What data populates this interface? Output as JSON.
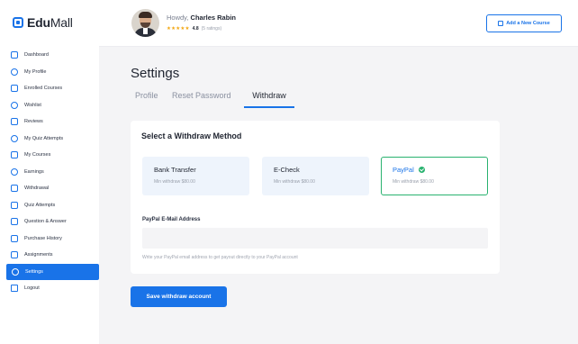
{
  "brand": {
    "part1": "Edu",
    "part2": "Mall",
    "color": "#1973e8"
  },
  "sidebar": {
    "items": [
      {
        "label": "Dashboard",
        "icon": "dashboard-icon"
      },
      {
        "label": "My Profile",
        "icon": "user-icon"
      },
      {
        "label": "Enrolled Courses",
        "icon": "courses-icon"
      },
      {
        "label": "Wishlist",
        "icon": "heart-icon"
      },
      {
        "label": "Reviews",
        "icon": "star-icon"
      },
      {
        "label": "My Quiz Attempts",
        "icon": "quiz-icon"
      },
      {
        "label": "My Courses",
        "icon": "monitor-icon"
      },
      {
        "label": "Earnings",
        "icon": "dollar-icon"
      },
      {
        "label": "Withdrawal",
        "icon": "wallet-icon"
      },
      {
        "label": "Quiz Attempts",
        "icon": "question-icon"
      },
      {
        "label": "Question & Answer",
        "icon": "chat-icon"
      },
      {
        "label": "Purchase History",
        "icon": "cart-icon"
      },
      {
        "label": "Assignments",
        "icon": "clipboard-icon"
      },
      {
        "label": "Settings",
        "icon": "gear-icon",
        "active": true
      },
      {
        "label": "Logout",
        "icon": "logout-icon"
      }
    ]
  },
  "header": {
    "greeting": "Howdy, ",
    "user_name": "Charles Rabin",
    "stars": "★★★★★",
    "rating_score": "4.8",
    "rating_count": "(5 ratings)",
    "add_course_label": "Add a New Course"
  },
  "main": {
    "title": "Settings",
    "tabs": [
      {
        "label": "Profile"
      },
      {
        "label": "Reset Password"
      },
      {
        "label": "Withdraw",
        "active": true
      }
    ],
    "withdraw": {
      "heading": "Select a Withdraw Method",
      "methods": [
        {
          "name": "Bank Transfer",
          "min": "Min withdraw $80.00"
        },
        {
          "name": "E-Check",
          "min": "Min withdraw $80.00"
        },
        {
          "name": "PayPal",
          "min": "Min withdraw $80.00",
          "selected": true
        }
      ],
      "email_label": "PayPal E-Mail Address",
      "email_value": "",
      "help_text": "Write your PayPal email address to get payout directly to your PayPal account"
    },
    "save_label": "Save withdraw account"
  },
  "colors": {
    "accent": "#1973e8",
    "success": "#29b26f",
    "star": "#f3a712"
  }
}
